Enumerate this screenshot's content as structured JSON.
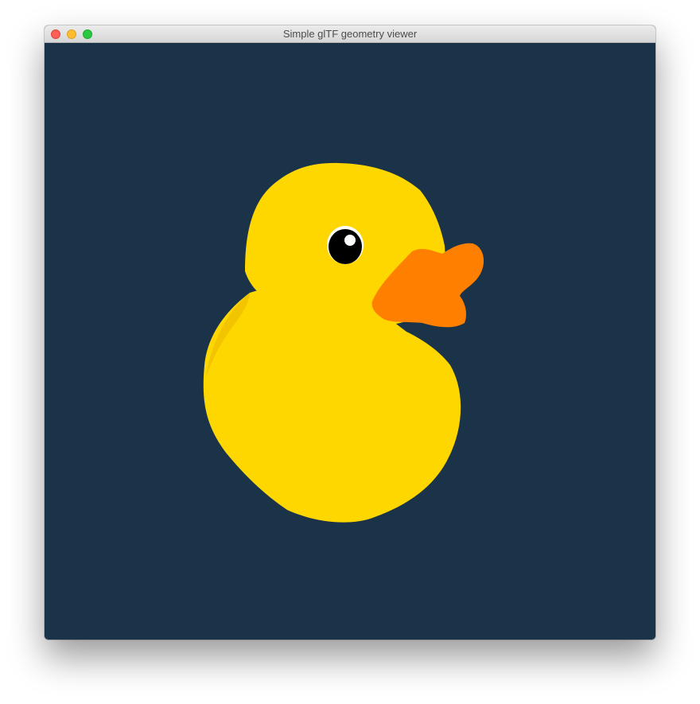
{
  "window": {
    "title": "Simple glTF geometry viewer"
  },
  "colors": {
    "background": "#1b3349",
    "duck_body": "#ffd700",
    "duck_shadow": "#f2c500",
    "beak": "#ff8000",
    "eye": "#000000",
    "eye_highlight": "#ffffff"
  },
  "scene": {
    "model": "duck"
  }
}
